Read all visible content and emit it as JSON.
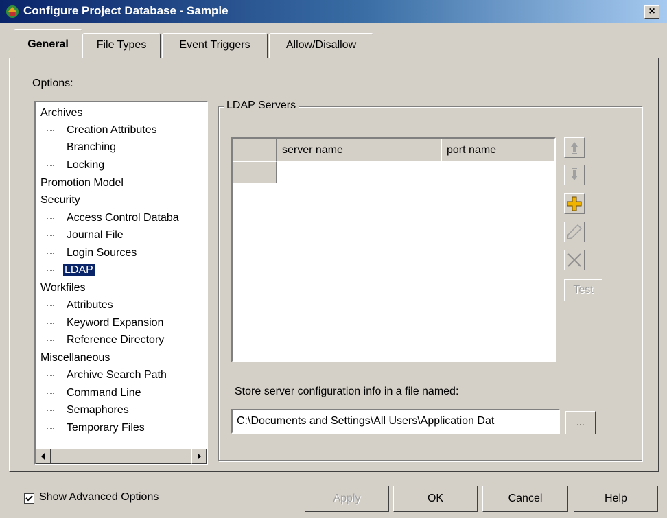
{
  "window": {
    "title": "Configure Project Database - Sample",
    "close_glyph": "×",
    "app_icon": "app-icon"
  },
  "tabs": [
    {
      "label": "General",
      "active": true
    },
    {
      "label": "File Types",
      "active": false
    },
    {
      "label": "Event Triggers",
      "active": false
    },
    {
      "label": "Allow/Disallow",
      "active": false
    }
  ],
  "options": {
    "label": "Options:",
    "tree": [
      {
        "label": "Archives",
        "children": [
          "Creation Attributes",
          "Branching",
          "Locking"
        ]
      },
      {
        "label": "Promotion Model",
        "children": []
      },
      {
        "label": "Security",
        "children": [
          "Access Control Databa",
          "Journal File",
          "Login Sources",
          "LDAP"
        ]
      },
      {
        "label": "Workfiles",
        "children": [
          "Attributes",
          "Keyword Expansion",
          "Reference Directory"
        ]
      },
      {
        "label": "Miscellaneous",
        "children": [
          "Archive Search Path",
          "Command Line",
          "Semaphores",
          "Temporary Files"
        ]
      }
    ],
    "selected": "LDAP"
  },
  "ldap": {
    "group_title": "LDAP Servers",
    "columns": [
      "server name",
      "port name"
    ],
    "rows": [],
    "buttons": {
      "move_up": "arrow-up-icon",
      "move_down": "arrow-down-icon",
      "add": "plus-icon",
      "edit": "pencil-icon",
      "delete": "x-icon",
      "test": "Test"
    },
    "store_label": "Store server configuration info in a file named:",
    "store_path": "C:\\Documents and Settings\\All Users\\Application Dat",
    "browse": "..."
  },
  "footer": {
    "show_advanced": {
      "label": "Show Advanced Options",
      "checked": true
    },
    "buttons": {
      "apply": "Apply",
      "ok": "OK",
      "cancel": "Cancel",
      "help": "Help"
    }
  },
  "colors": {
    "titlebar": "#0a246a",
    "face": "#d4d0c8",
    "selection": "#0a246a",
    "add_icon": "#f0b400"
  }
}
